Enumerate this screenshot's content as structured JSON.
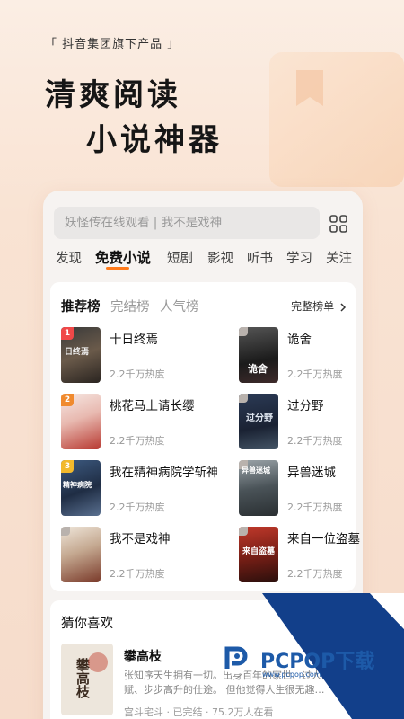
{
  "promo": {
    "tagline": "「 抖音集团旗下产品 」",
    "headline_line1": "清爽阅读",
    "headline_line2": "小说神器"
  },
  "app": {
    "search_placeholder": "妖怪传在线观看 | 我不是戏神",
    "tabs": [
      {
        "label": "发现",
        "active": false
      },
      {
        "label": "免费小说",
        "active": true
      },
      {
        "label": "短剧",
        "active": false
      },
      {
        "label": "影视",
        "active": false
      },
      {
        "label": "听书",
        "active": false
      },
      {
        "label": "学习",
        "active": false
      },
      {
        "label": "关注",
        "active": false
      }
    ],
    "ranking": {
      "tabs": [
        {
          "label": "推荐榜",
          "active": true
        },
        {
          "label": "完结榜",
          "active": false
        },
        {
          "label": "人气榜",
          "active": false
        }
      ],
      "full_list_label": "完整榜单",
      "chevron_icon": "chevron-right-icon",
      "books": [
        {
          "rank": "1",
          "title": "十日终焉",
          "heat": "2.2千万热度"
        },
        {
          "rank": "",
          "title": "诡舍",
          "heat": "2.2千万热度"
        },
        {
          "rank": "2",
          "title": "桃花马上请长缨",
          "heat": "2.2千万热度"
        },
        {
          "rank": "",
          "title": "过分野",
          "heat": "2.2千万热度"
        },
        {
          "rank": "3",
          "title": "我在精神病院学斩神",
          "heat": "2.2千万热度"
        },
        {
          "rank": "",
          "title": "异兽迷城",
          "heat": "2.2千万热度"
        },
        {
          "rank": "",
          "title": "我不是戏神",
          "heat": "2.2千万热度"
        },
        {
          "rank": "",
          "title": "来自一位盗墓",
          "heat": "2.2千万热度"
        }
      ],
      "cover_texts": [
        "日终焉",
        "诡舍",
        "",
        "过分野",
        "精神病院",
        "异兽迷城",
        "",
        "来自盗墓"
      ]
    },
    "guess": {
      "title": "猜你喜欢",
      "book_title": "攀高枝",
      "cover_text": "攀高枝",
      "description": "张知序天生拥有一切。出身百年的家世、过人的天赋、步步高升的仕途。 但他觉得人生很无趣…",
      "meta": "宫斗宅斗 · 已完结 · 75.2万人在看"
    }
  },
  "watermark": {
    "brand": "PCPOP下载",
    "sub": "www.pcpop.com"
  },
  "colors": {
    "accent": "#ff7a1a",
    "rank1": "#f04848",
    "rank2": "#f08a2e",
    "rank3": "#f2b92c",
    "rank_other": "#b9b2ad",
    "watermark_blue": "#1d5aa8"
  }
}
